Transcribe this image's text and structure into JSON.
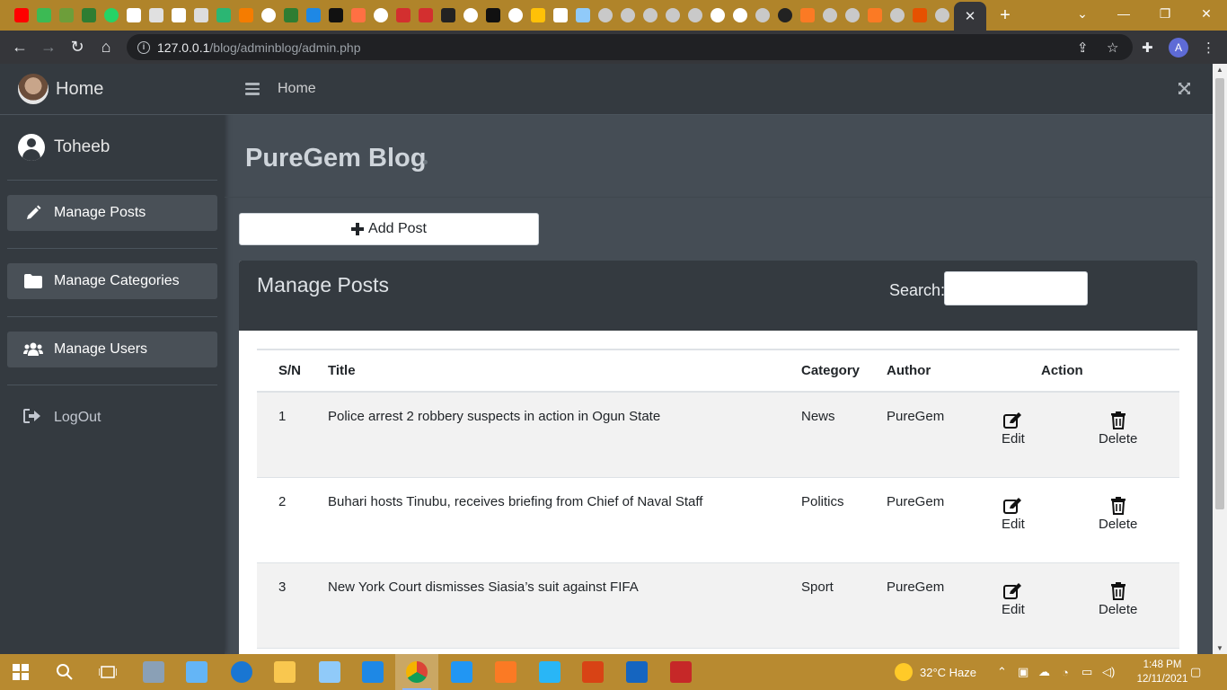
{
  "browser": {
    "active_tab_close": "✕",
    "new_tab": "+",
    "url_host": "127.0.0.1",
    "url_path": "/blog/adminblog/admin.php",
    "profile_initial": "A"
  },
  "sidebar": {
    "brand": "Home",
    "user": "Toheeb",
    "items": [
      {
        "label": "Manage Posts",
        "icon": "pencil-icon"
      },
      {
        "label": "Manage Categories",
        "icon": "folder-icon"
      },
      {
        "label": "Manage Users",
        "icon": "users-icon"
      }
    ],
    "logout": "LogOut"
  },
  "topnav": {
    "home": "Home"
  },
  "header": {
    "title": "PureGem Blog"
  },
  "add_post": {
    "label": "Add Post"
  },
  "posts_card": {
    "title": "Manage Posts",
    "search_label": "Search:",
    "columns": [
      "S/N",
      "Title",
      "Category",
      "Author",
      "Action"
    ],
    "rows": [
      {
        "sn": "1",
        "title": "Police arrest 2 robbery suspects in action in Ogun State",
        "category": "News",
        "author": "PureGem",
        "edit": "Edit",
        "delete": "Delete"
      },
      {
        "sn": "2",
        "title": "Buhari hosts Tinubu, receives briefing from Chief of Naval Staff",
        "category": "Politics",
        "author": "PureGem",
        "edit": "Edit",
        "delete": "Delete"
      },
      {
        "sn": "3",
        "title": "New York Court dismisses Siasia’s suit against FIFA",
        "category": "Sport",
        "author": "PureGem",
        "edit": "Edit",
        "delete": "Delete"
      }
    ]
  },
  "taskbar": {
    "weather": "32°C  Haze",
    "time": "1:48 PM",
    "date": "12/11/2021"
  }
}
